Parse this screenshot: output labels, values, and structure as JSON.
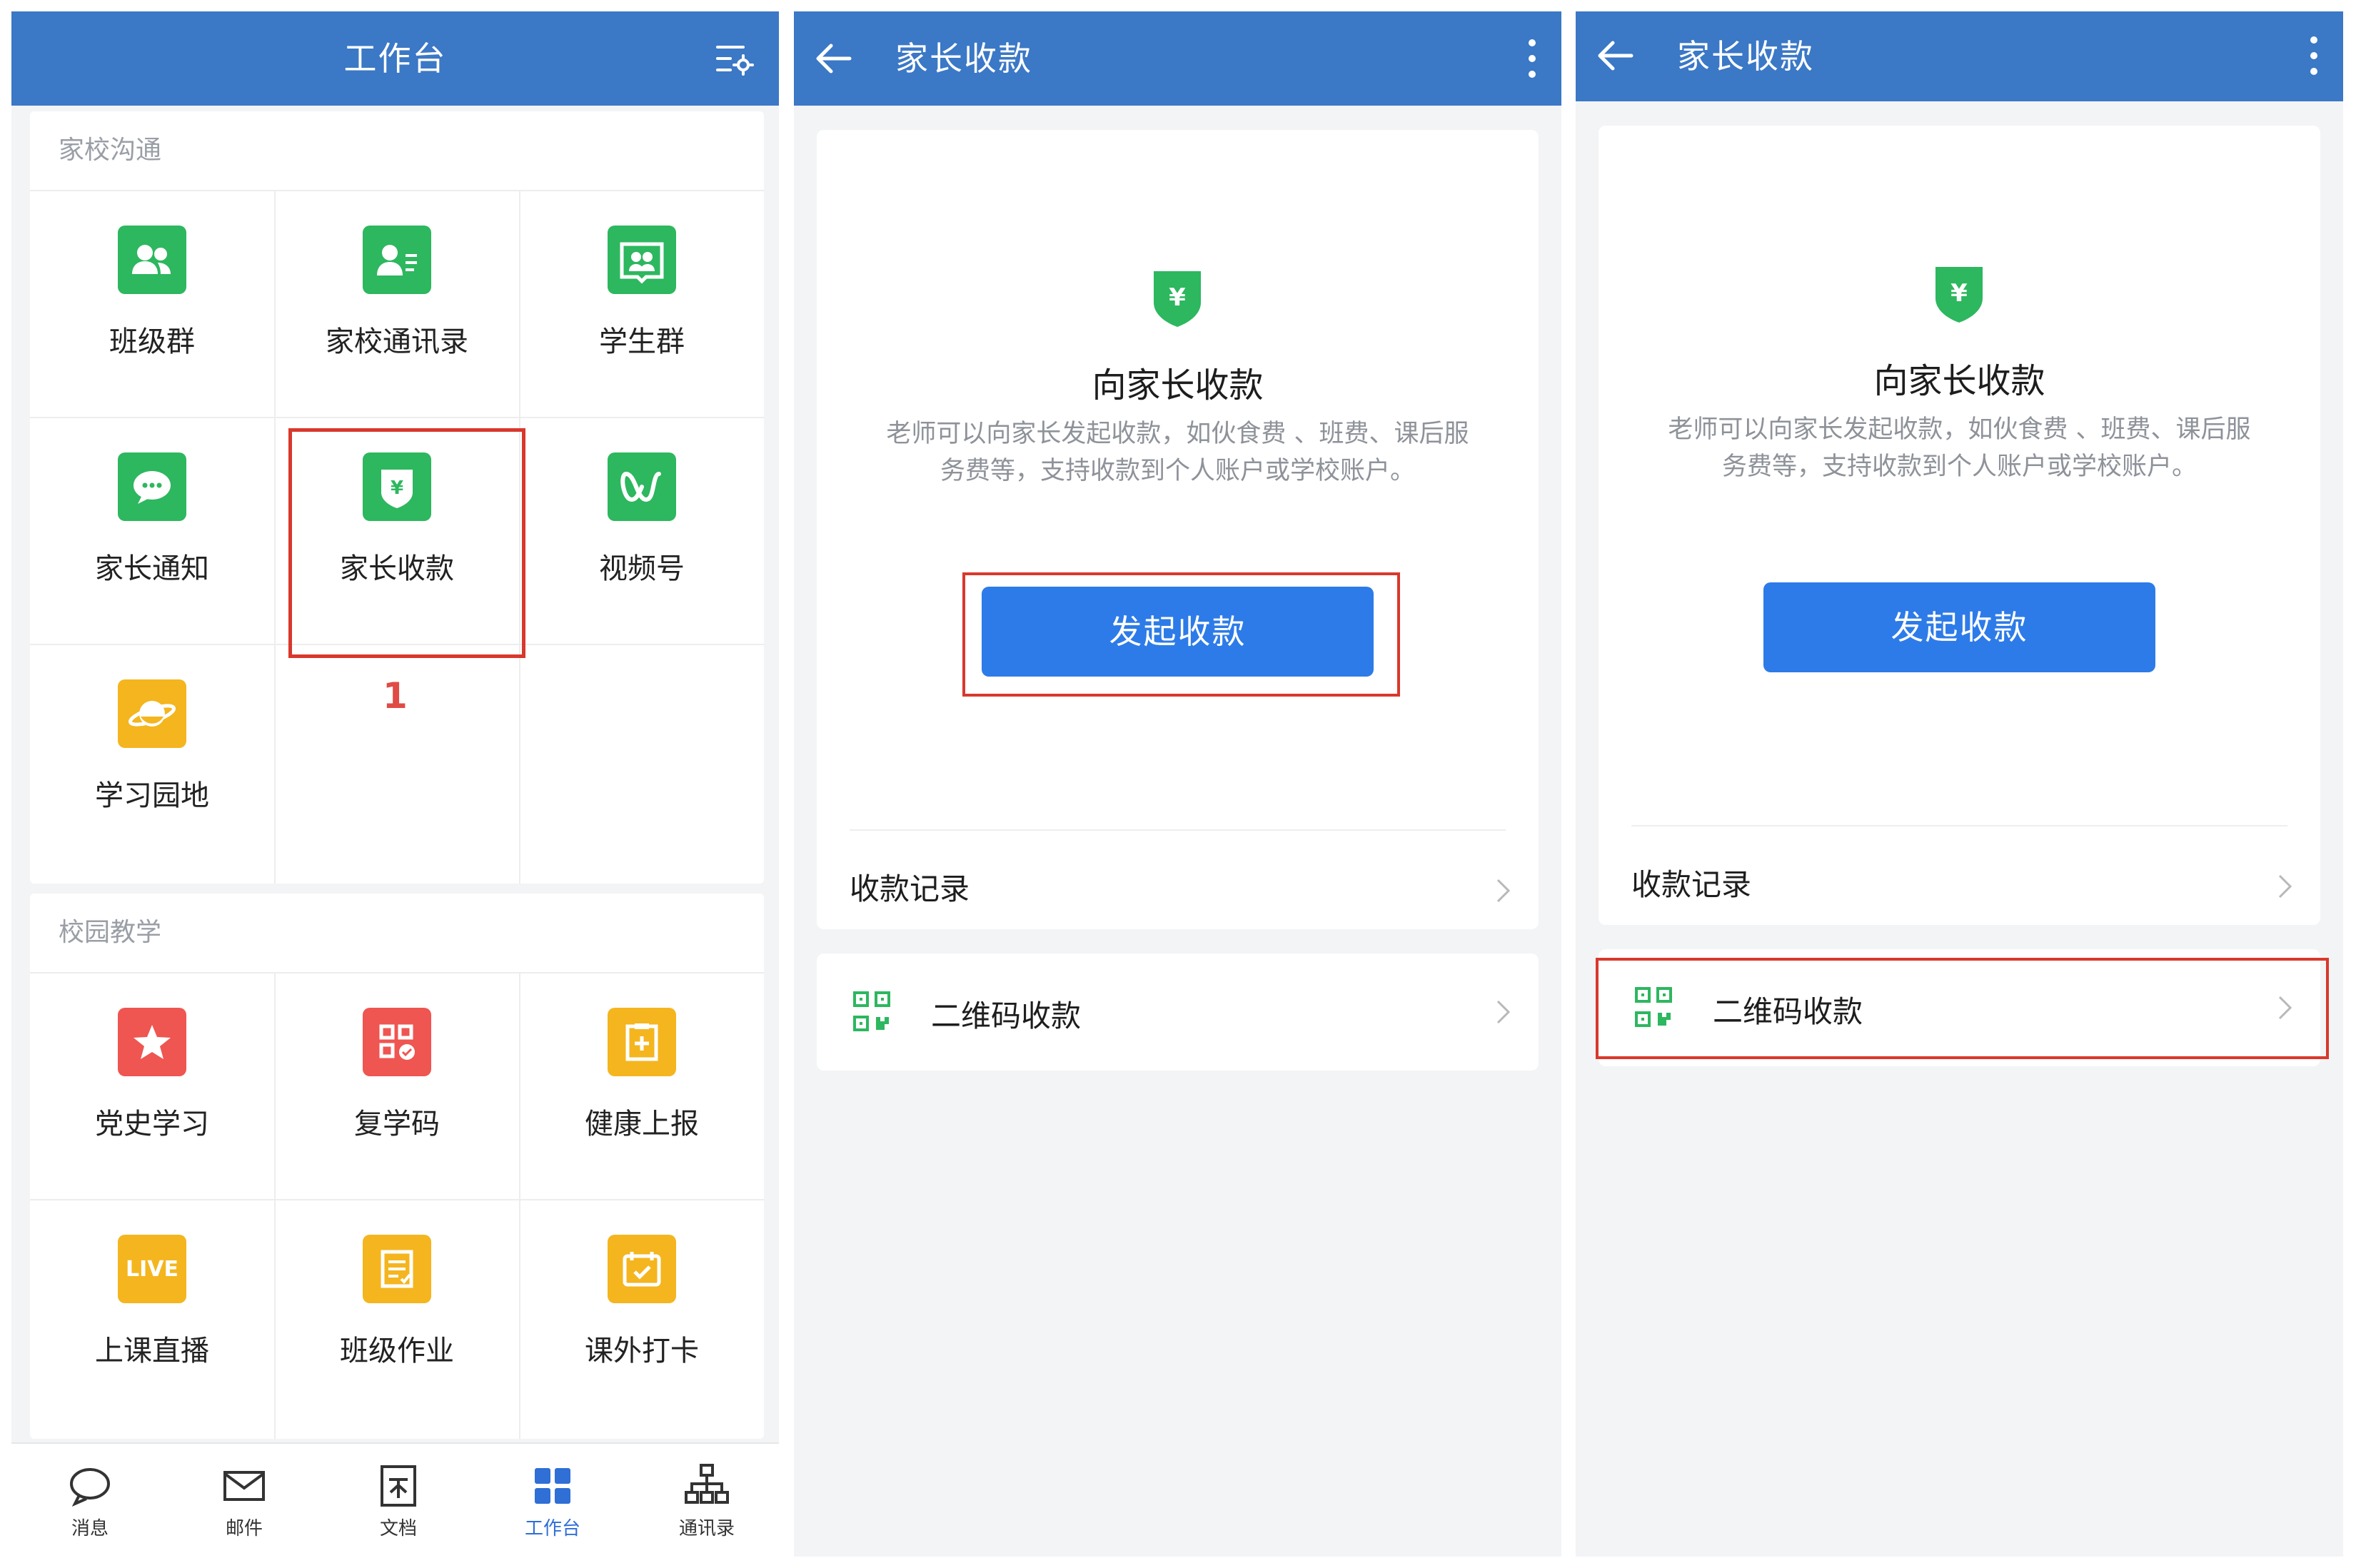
{
  "panel1": {
    "header": {
      "title": "工作台",
      "settings_icon": "list-settings-icon"
    },
    "section_home_school": {
      "title": "家校沟通",
      "items": [
        {
          "label": "班级群",
          "icon": "group-icon",
          "color": "#2db75f"
        },
        {
          "label": "家校通讯录",
          "icon": "contact-card-icon",
          "color": "#2db75f"
        },
        {
          "label": "学生群",
          "icon": "student-group-icon",
          "color": "#2db75f"
        },
        {
          "label": "家长通知",
          "icon": "chat-bubble-icon",
          "color": "#2db75f"
        },
        {
          "label": "家长收款",
          "icon": "payment-shield-icon",
          "color": "#2db75f"
        },
        {
          "label": "视频号",
          "icon": "video-channel-icon",
          "color": "#2db75f"
        },
        {
          "label": "学习园地",
          "icon": "planet-icon",
          "color": "#f4b51e"
        }
      ]
    },
    "step_marker": "1",
    "section_campus": {
      "title": "校园教学",
      "items": [
        {
          "label": "党史学习",
          "icon": "star-icon",
          "color": "#ef5551"
        },
        {
          "label": "复学码",
          "icon": "qr-check-icon",
          "color": "#ef5551"
        },
        {
          "label": "健康上报",
          "icon": "health-report-icon",
          "color": "#f4b51e"
        },
        {
          "label": "上课直播",
          "icon": "live-icon",
          "icon_text": "LIVE",
          "color": "#f4b51e"
        },
        {
          "label": "班级作业",
          "icon": "homework-icon",
          "color": "#f4b51e"
        },
        {
          "label": "课外打卡",
          "icon": "check-in-icon",
          "color": "#f4b51e"
        }
      ]
    },
    "bottom_nav": [
      {
        "label": "消息",
        "icon": "message-icon"
      },
      {
        "label": "邮件",
        "icon": "mail-icon"
      },
      {
        "label": "文档",
        "icon": "document-icon"
      },
      {
        "label": "工作台",
        "icon": "workbench-icon",
        "active": true
      },
      {
        "label": "通讯录",
        "icon": "org-chart-icon"
      }
    ]
  },
  "panel2": {
    "header": {
      "title": "家长收款"
    },
    "card": {
      "title": "向家长收款",
      "description_line1": "老师可以向家长发起收款，如伙食费 、班费、课后服",
      "description_line2": "务费等，支持收款到个人账户或学校账户。",
      "button": "发起收款",
      "records": "收款记录"
    },
    "qr_row": "二维码收款"
  },
  "panel3": {
    "header": {
      "title": "家长收款"
    },
    "card": {
      "title": "向家长收款",
      "description_line1": "老师可以向家长发起收款，如伙食费 、班费、课后服",
      "description_line2": "务费等，支持收款到个人账户或学校账户。",
      "button": "发起收款",
      "records": "收款记录"
    },
    "qr_row": "二维码收款"
  },
  "colors": {
    "header": "#3b78c6",
    "primary_button": "#2d7be8",
    "highlight": "#d9382c",
    "green_icon": "#2db75f",
    "red_icon": "#ef5551",
    "orange_icon": "#f4b51e",
    "active_nav": "#2f6fd6"
  }
}
